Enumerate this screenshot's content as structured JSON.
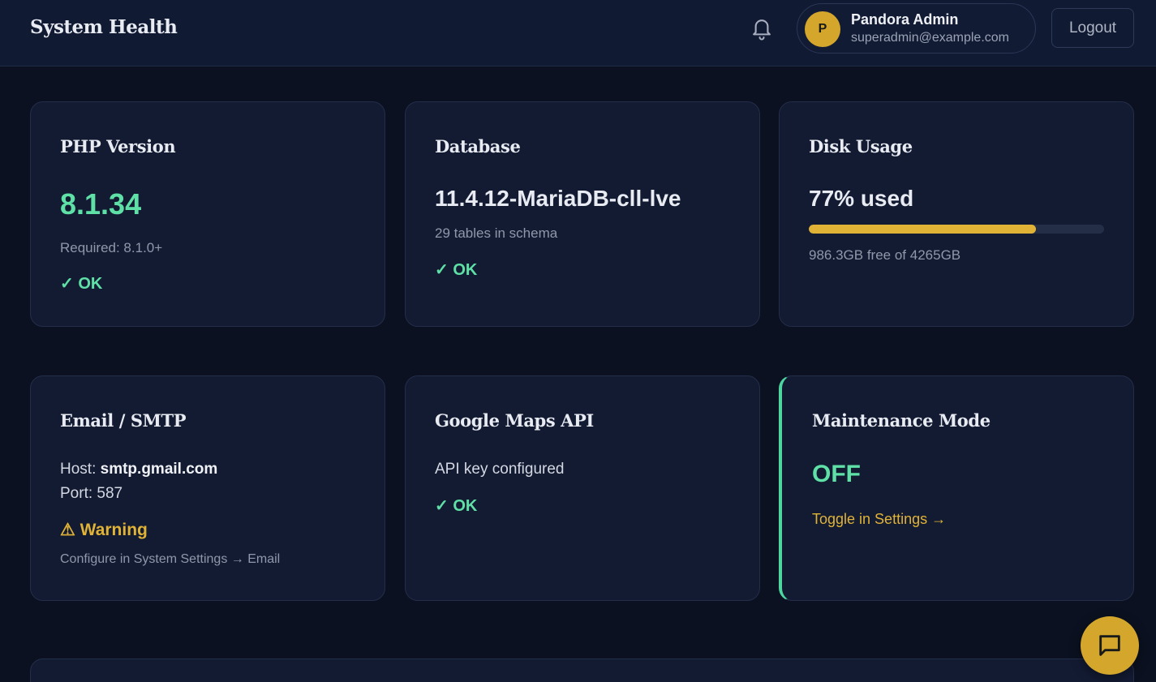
{
  "header": {
    "title": "System Health",
    "user": {
      "initial": "P",
      "name": "Pandora Admin",
      "email": "superadmin@example.com"
    },
    "logout_label": "Logout"
  },
  "cards": {
    "php": {
      "title": "PHP Version",
      "value": "8.1.34",
      "required": "Required: 8.1.0+",
      "status": "✓ OK"
    },
    "database": {
      "title": "Database",
      "value": "11.4.12-MariaDB-cll-lve",
      "detail": "29 tables in schema",
      "status": "✓ OK"
    },
    "disk": {
      "title": "Disk Usage",
      "value": "77% used",
      "percent_used": 77,
      "detail": "986.3GB free of 4265GB"
    },
    "email": {
      "title": "Email / SMTP",
      "host_label": "Host:",
      "host_value": "smtp.gmail.com",
      "port": "Port: 587",
      "status": "⚠ Warning",
      "hint": "Configure in System Settings → Email"
    },
    "maps": {
      "title": "Google Maps API",
      "detail": "API key configured",
      "status": "✓ OK"
    },
    "maintenance": {
      "title": "Maintenance Mode",
      "value": "OFF",
      "link": "Toggle in Settings →"
    }
  },
  "icons": {
    "notifications": "bell-icon",
    "chat": "chat-icon"
  },
  "colors": {
    "ok": "#5ee0a6",
    "warning": "#e0b336",
    "accent": "#d4a72c"
  }
}
